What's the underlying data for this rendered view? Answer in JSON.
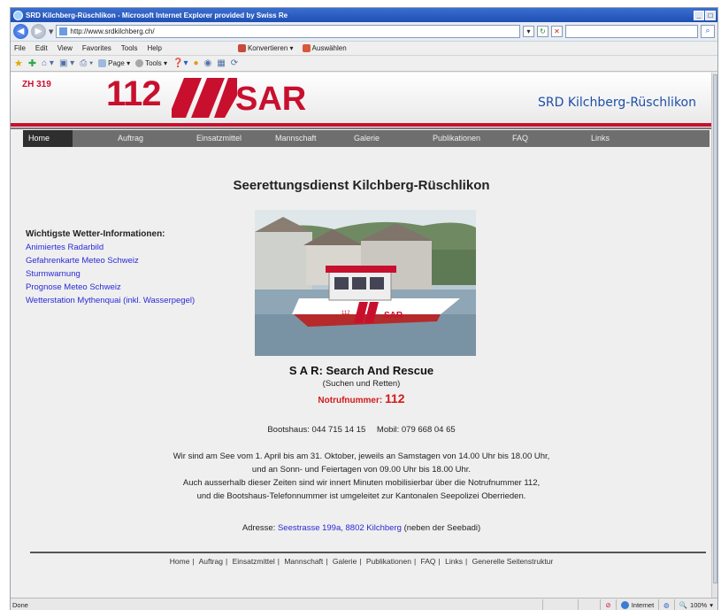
{
  "browser": {
    "title": "SRD Kilchberg-Rüschlikon - Microsoft Internet Explorer provided by Swiss Re",
    "url": "http://www.srdkilchberg.ch/",
    "menu": [
      "File",
      "Edit",
      "View",
      "Favorites",
      "Tools",
      "Help"
    ],
    "toolbar_extras": [
      "Konvertieren",
      "Auswählen"
    ],
    "favbar": [
      "Page",
      "Tools"
    ],
    "status": "Done",
    "zone": "Internet",
    "zoom": "100%"
  },
  "site": {
    "code": "ZH 319",
    "number": "112",
    "logo_text": "SAR",
    "name": "SRD Kilchberg-Rüschlikon"
  },
  "nav": [
    "Home",
    "Auftrag",
    "Einsatzmittel",
    "Mannschaft",
    "Galerie",
    "Publikationen",
    "FAQ",
    "Links"
  ],
  "main": {
    "title": "Seerettungsdienst Kilchberg-Rüschlikon",
    "weather_heading": "Wichtigste Wetter-Informationen:",
    "weather_links": [
      "Animiertes Radarbild",
      "Gefahrenkarte Meteo Schweiz",
      "Sturmwarnung",
      "Prognose Meteo Schweiz",
      "Wetterstation Mythenquai (inkl. Wasserpegel)"
    ],
    "sar_title": "S A R: Search And Rescue",
    "sar_subtitle": "(Suchen und Retten)",
    "notruf_label": "Notrufnummer:",
    "notruf_number": "112",
    "bootshaus": "Bootshaus: 044 715 14 15",
    "mobil": "Mobil: 079 668 04 65",
    "info_lines": [
      "Wir sind am See vom 1. April bis am 31. Oktober, jeweils an Samstagen von 14.00 Uhr bis 18.00 Uhr,",
      "und an Sonn- und Feiertagen von 09.00 Uhr bis 18.00 Uhr.",
      "Auch ausserhalb dieser Zeiten sind wir innert Minuten mobilisierbar über die Notrufnummer 112,",
      "und die Bootshaus-Telefonnummer ist umgeleitet zur Kantonalen Seepolizei Oberrieden."
    ],
    "address_label": "Adresse:",
    "address_link": "Seestrasse 199a, 8802 Kilchberg",
    "address_note": "(neben der Seebadi)"
  },
  "footer": [
    "Home",
    "Auftrag",
    "Einsatzmittel",
    "Mannschaft",
    "Galerie",
    "Publikationen",
    "FAQ",
    "Links",
    "Generelle Seitenstruktur"
  ],
  "colors": {
    "brand_red": "#c8102e",
    "link_blue": "#2a2ad8",
    "nav_grey": "#6e6e6e"
  }
}
